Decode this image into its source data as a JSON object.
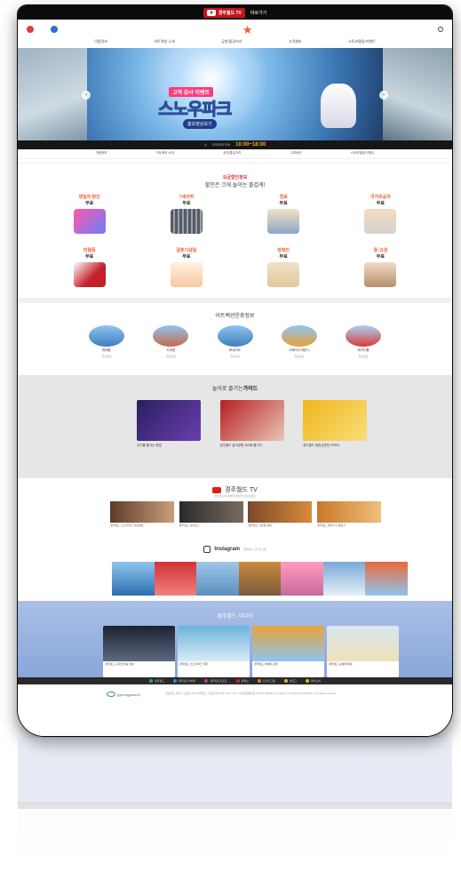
{
  "top_bar": {
    "tv_label": "경주월드 TV",
    "go_label": "바로가기"
  },
  "gnb": [
    "이용정보",
    "어트랙션 소개",
    "공연/즐길거리",
    "고객센터",
    "스토리텔링/이벤트"
  ],
  "hero": {
    "tag": "고객 감사 이벤트",
    "title": "스노우파크",
    "button": "홍보영상보기",
    "prev_glyph": "‹",
    "next_glyph": "›"
  },
  "hours": {
    "label": "OPERATION",
    "time": "10:00~18:00"
  },
  "discount": {
    "subtitle": "요금할인정보",
    "title": "할인은 크게 놀이는 즐겁게!",
    "items": [
      {
        "label": "생일자 본인",
        "free": "무료",
        "color": "#c86ef0"
      },
      {
        "label": "7세이하",
        "free": "무료",
        "color": "#555c66"
      },
      {
        "label": "경로",
        "free": "무료",
        "color": "#d9c7a3"
      },
      {
        "label": "국가유공자",
        "free": "무료",
        "color": "#cfc7bb"
      },
      {
        "label": "헌혈증",
        "free": "무료",
        "color": "#c2202a"
      },
      {
        "label": "결혼기념일",
        "free": "무료",
        "color": "#f7d3a7"
      },
      {
        "label": "장애인",
        "free": "무료",
        "color": "#e9d9b8"
      },
      {
        "label": "중·고생",
        "free": "무료",
        "color": "#d8c0a8"
      }
    ]
  },
  "attractions": {
    "title": "어트랙션운휴정보",
    "items": [
      {
        "name": "파에톤",
        "status": "정상운영"
      },
      {
        "name": "드라켄",
        "status": "정상운영"
      },
      {
        "name": "토네이도",
        "status": "정상운영"
      },
      {
        "name": "크레이지 마운스",
        "status": "정상운영"
      },
      {
        "name": "메가드롭",
        "status": "정상운영"
      }
    ]
  },
  "guide": {
    "title_prefix": "놀이로 즐기는",
    "title_bold": "가이드",
    "cards": [
      {
        "caption": "우주를 즐기는 방법",
        "color": "#3a2a6e"
      },
      {
        "caption": "경주월드 놀이공원 100배 즐기기",
        "color": "#b81e1e"
      },
      {
        "caption": "경주월드 청춘심판방 OPEN",
        "color": "#f2b51b"
      }
    ]
  },
  "tv": {
    "title": "경주월드 TV",
    "subtitle": "경주월드의 생생한 영상을 만나보세요",
    "cards": [
      {
        "caption": "경주월드 스노우파크 홍보영상",
        "color": "#5e3b2a"
      },
      {
        "caption": "경주월드 브이로그",
        "color": "#2a2a2a"
      },
      {
        "caption": "경주월드 할로윈 축제",
        "color": "#7a4a2a"
      },
      {
        "caption": "경주월드 놀이기구 탑승기",
        "color": "#c9782a"
      }
    ]
  },
  "instagram": {
    "title": "Instagram",
    "subtitle": "경주월드 인스타그램",
    "colors": [
      "#2f6fb0",
      "#d23333",
      "#a0c6e8",
      "#c98b3b",
      "#ff9cc0",
      "#7aa9d8",
      "#e76b39"
    ]
  },
  "media": {
    "title": "경주월드 미디어",
    "cards": [
      {
        "caption": "경주월드 드라켄 탑승 영상",
        "color": "#2a2e3a"
      },
      {
        "caption": "경주월드 스노우파크 개장",
        "color": "#6cb3d9"
      },
      {
        "caption": "경주월드 파에톤 운행",
        "color": "#e6a23a"
      },
      {
        "caption": "경주월드 눈썰매 체험",
        "color": "#d8e6f0"
      }
    ]
  },
  "links": [
    {
      "label": "경주월드",
      "color": "#3ba35b"
    },
    {
      "label": "캘리포니아비치",
      "color": "#2f8fd8"
    },
    {
      "label": "경주월드리조트",
      "color": "#b73b8a"
    },
    {
      "label": "유튜브",
      "color": "#e22222"
    },
    {
      "label": "인스타그램",
      "color": "#e27a22"
    },
    {
      "label": "블로그",
      "color": "#e2b822"
    },
    {
      "label": "페이스북",
      "color": "#e2b822"
    }
  ],
  "footer": {
    "brand": "gyeongjuworld",
    "info": "경상북도 경주시 보문로 544 경주월드 | 대표전화 054-745-7711 | 사업자등록번호 000-00-00000 Copyright © GYEONGJUWORLD. All rights reserved."
  }
}
